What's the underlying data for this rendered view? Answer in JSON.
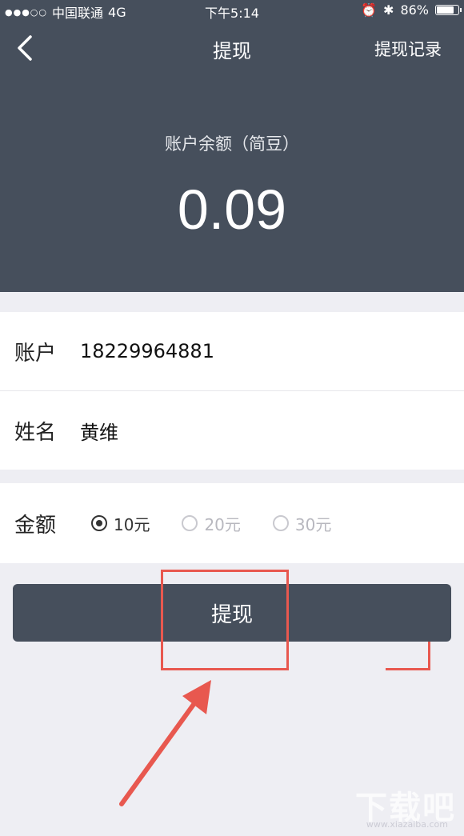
{
  "status_bar": {
    "carrier": "中国联通",
    "network": "4G",
    "time": "下午5:14",
    "battery": "86%",
    "battery_level": 0.86
  },
  "nav": {
    "title": "提现",
    "right_link": "提现记录"
  },
  "balance": {
    "label": "账户余额（简豆）",
    "value": "0.09"
  },
  "form": {
    "account_label": "账户",
    "account_value": "18229964881",
    "name_label": "姓名",
    "name_value": "黄维",
    "amount_label": "金额",
    "amount_options": [
      "10元",
      "20元",
      "30元"
    ],
    "amount_selected": "10元"
  },
  "submit_label": "提现",
  "watermark": {
    "text": "下载吧",
    "url": "www.xiazaiba.com"
  },
  "colors": {
    "header_bg": "#464f5c",
    "accent": "#e8584f"
  }
}
